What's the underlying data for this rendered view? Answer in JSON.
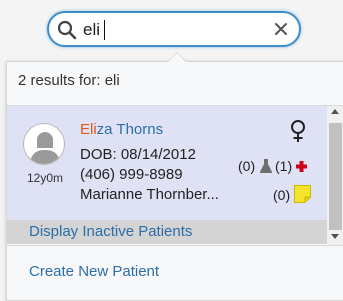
{
  "search": {
    "value": "eli",
    "icon": "search-icon",
    "clear_icon": "close-icon"
  },
  "results": {
    "count_text": "2 results for: eli"
  },
  "patient": {
    "name_highlight": "Eli",
    "name_rest": "za Thorns",
    "age": "12y0m",
    "dob": "DOB: 08/14/2012",
    "phone": "(406) 999-8989",
    "guardian": "Marianne Thornber...",
    "gender_icon": "female-icon",
    "lab_count": "(0)",
    "med_count": "(1)",
    "note_count": "(0)"
  },
  "actions": {
    "inactive_label": "Display Inactive Patients",
    "create_label": "Create New Patient"
  },
  "colors": {
    "accent": "#3d8ec9",
    "link": "#2b6ea8",
    "highlight": "#e05a1a",
    "card_bg": "#dfe2f5",
    "alert_red": "#d0021b",
    "note_yellow": "#f5e52a"
  }
}
